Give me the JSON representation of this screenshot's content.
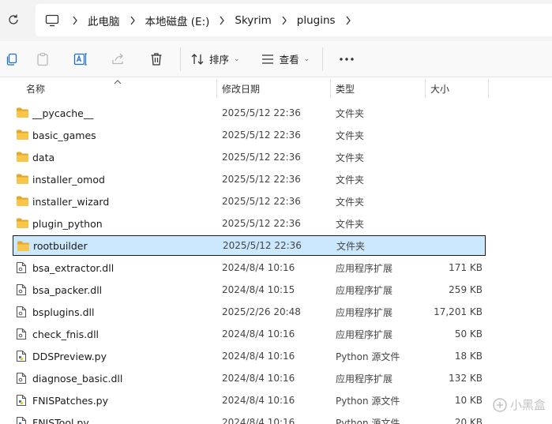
{
  "address": {
    "crumbs": [
      "此电脑",
      "本地磁盘 (E:)",
      "Skyrim",
      "plugins"
    ]
  },
  "toolbar": {
    "sort_label": "排序",
    "view_label": "查看"
  },
  "columns": {
    "name": "名称",
    "date": "修改日期",
    "type": "类型",
    "size": "大小"
  },
  "files": [
    {
      "name": "__pycache__",
      "date": "2025/5/12 22:36",
      "type": "文件夹",
      "size": "",
      "kind": "folder"
    },
    {
      "name": "basic_games",
      "date": "2025/5/12 22:36",
      "type": "文件夹",
      "size": "",
      "kind": "folder"
    },
    {
      "name": "data",
      "date": "2025/5/12 22:36",
      "type": "文件夹",
      "size": "",
      "kind": "folder"
    },
    {
      "name": "installer_omod",
      "date": "2025/5/12 22:36",
      "type": "文件夹",
      "size": "",
      "kind": "folder"
    },
    {
      "name": "installer_wizard",
      "date": "2025/5/12 22:36",
      "type": "文件夹",
      "size": "",
      "kind": "folder"
    },
    {
      "name": "plugin_python",
      "date": "2025/5/12 22:36",
      "type": "文件夹",
      "size": "",
      "kind": "folder"
    },
    {
      "name": "rootbuilder",
      "date": "2025/5/12 22:36",
      "type": "文件夹",
      "size": "",
      "kind": "folder",
      "selected": true
    },
    {
      "name": "bsa_extractor.dll",
      "date": "2024/8/4 10:16",
      "type": "应用程序扩展",
      "size": "171 KB",
      "kind": "dll"
    },
    {
      "name": "bsa_packer.dll",
      "date": "2024/8/4 10:15",
      "type": "应用程序扩展",
      "size": "259 KB",
      "kind": "dll"
    },
    {
      "name": "bsplugins.dll",
      "date": "2025/2/26 20:48",
      "type": "应用程序扩展",
      "size": "17,201 KB",
      "kind": "dll"
    },
    {
      "name": "check_fnis.dll",
      "date": "2024/8/4 10:16",
      "type": "应用程序扩展",
      "size": "50 KB",
      "kind": "dll"
    },
    {
      "name": "DDSPreview.py",
      "date": "2024/8/4 10:16",
      "type": "Python 源文件",
      "size": "18 KB",
      "kind": "py"
    },
    {
      "name": "diagnose_basic.dll",
      "date": "2024/8/4 10:16",
      "type": "应用程序扩展",
      "size": "132 KB",
      "kind": "dll"
    },
    {
      "name": "FNISPatches.py",
      "date": "2024/8/4 10:16",
      "type": "Python 源文件",
      "size": "10 KB",
      "kind": "py"
    },
    {
      "name": "FNISTool.py",
      "date": "2024/8/4 10:16",
      "type": "Python 源文件",
      "size": "20 KB",
      "kind": "py"
    }
  ],
  "watermark": "小黑盒",
  "colors": {
    "folder": "#f8c64a",
    "folder_dark": "#e2a72d",
    "selection": "#cce8ff",
    "accent": "#0067c0"
  }
}
